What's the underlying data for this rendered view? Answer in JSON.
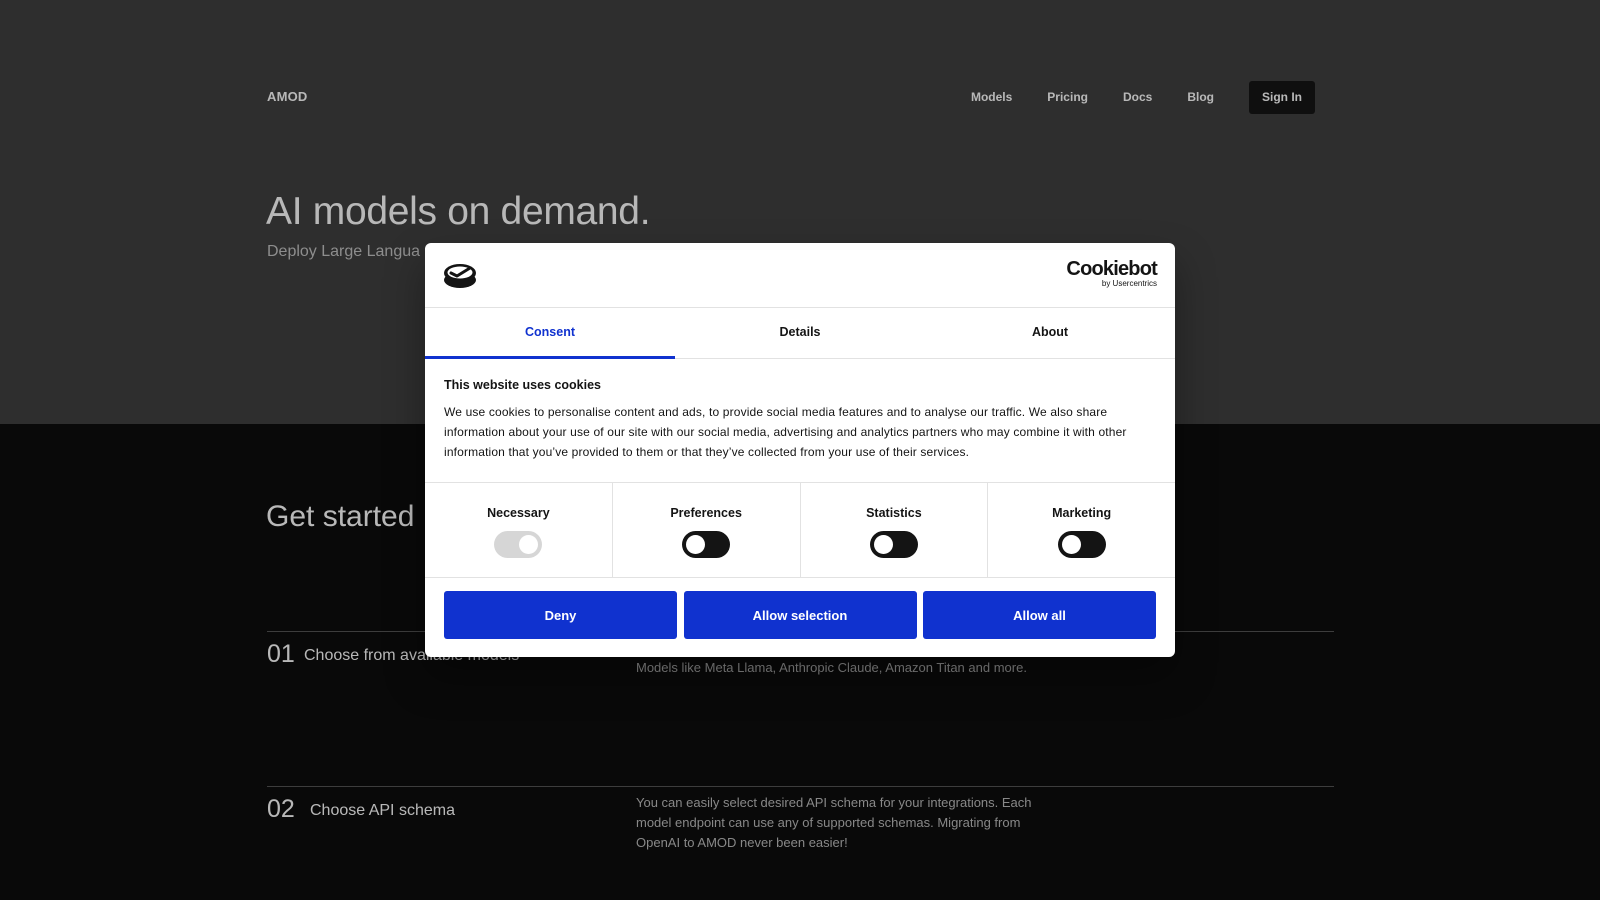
{
  "header": {
    "logo": "AMOD",
    "nav": [
      "Models",
      "Pricing",
      "Docs",
      "Blog"
    ],
    "signin": "Sign In"
  },
  "hero": {
    "title": "AI models on demand.",
    "subtitle": "Deploy Large Langua"
  },
  "getting_started": {
    "title": "Get started",
    "steps": [
      {
        "num": "01",
        "title": "Choose from available models",
        "desc": "Models like Meta Llama, Anthropic Claude, Amazon Titan and more."
      },
      {
        "num": "02",
        "title": "Choose API schema",
        "desc": "You can easily select desired API schema for your integrations. Each model endpoint can use any of supported schemas. Migrating from OpenAI to AMOD never been easier!"
      }
    ]
  },
  "dialog": {
    "brand": "Cookiebot",
    "brand_sub": "by Usercentrics",
    "tabs": [
      "Consent",
      "Details",
      "About"
    ],
    "heading": "This website uses cookies",
    "text": "We use cookies to personalise content and ads, to provide social media features and to analyse our traffic. We also share information about your use of our site with our social media, advertising and analytics partners who may combine it with other information that you’ve provided to them or that they’ve collected from your use of their services.",
    "categories": [
      {
        "label": "Necessary",
        "enabled": true,
        "locked": true
      },
      {
        "label": "Preferences",
        "enabled": false,
        "locked": false
      },
      {
        "label": "Statistics",
        "enabled": false,
        "locked": false
      },
      {
        "label": "Marketing",
        "enabled": false,
        "locked": false
      }
    ],
    "buttons": [
      "Deny",
      "Allow selection",
      "Allow all"
    ]
  },
  "colors": {
    "accent": "#1032cf",
    "hero_bg": "#404040",
    "page_bg": "#0d0d0d"
  }
}
